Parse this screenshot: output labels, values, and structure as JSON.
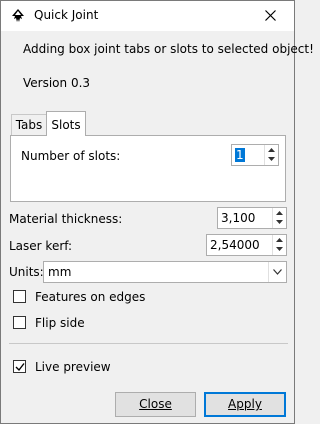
{
  "window": {
    "title": "Quick Joint",
    "description": "Adding box joint tabs or slots to selected object!",
    "version": "Version 0.3"
  },
  "tabs": [
    {
      "label": "Tabs",
      "selected": false
    },
    {
      "label": "Slots",
      "selected": true
    }
  ],
  "slots_panel": {
    "number_of_slots_label": "Number of slots:",
    "number_of_slots_value": "1"
  },
  "fields": {
    "material_thickness_label": "Material thickness:",
    "material_thickness_value": "3,100",
    "laser_kerf_label": "Laser kerf:",
    "laser_kerf_value": "2,54000",
    "units_label": "Units:",
    "units_value": "mm"
  },
  "checkboxes": {
    "features_on_edges": {
      "label": "Features on edges",
      "checked": false
    },
    "flip_side": {
      "label": "Flip side",
      "checked": false
    },
    "live_preview": {
      "label": "Live preview",
      "checked": true
    }
  },
  "buttons": {
    "close_label": "Close",
    "apply_label": "Apply"
  },
  "colors": {
    "accent": "#0078d7",
    "window_bg": "#f0f0f0",
    "button_bg": "#e1e1e1"
  },
  "icons": {
    "app": "inkscape-icon",
    "close": "close-icon",
    "spin_up": "chevron-up-icon",
    "spin_down": "chevron-down-icon",
    "dropdown": "chevron-down-icon",
    "check": "check-icon"
  }
}
